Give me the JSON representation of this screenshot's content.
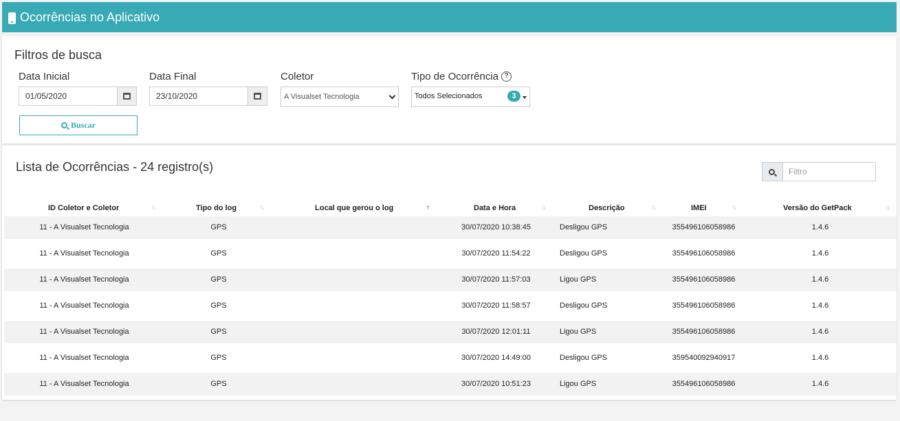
{
  "header": {
    "title": "Ocorrências no Aplicativo"
  },
  "filters": {
    "title": "Filtros de busca",
    "data_inicial": {
      "label": "Data Inicial",
      "value": "01/05/2020"
    },
    "data_final": {
      "label": "Data Final",
      "value": "23/10/2020"
    },
    "coletor": {
      "label": "Coletor",
      "value": "A Visualset Tecnologia"
    },
    "tipo": {
      "label": "Tipo de Ocorrência",
      "help": "?",
      "value": "Todos Selecionados",
      "count": "3"
    },
    "buscar_label": "Buscar"
  },
  "list": {
    "title": "Lista de Ocorrências - 24 registro(s)",
    "filter_placeholder": "Filtro",
    "columns": [
      "ID Coletor e Coletor",
      "Tipo do log",
      "Local que gerou o log",
      "Data e Hora",
      "Descrição",
      "IMEI",
      "Versão do GetPack"
    ],
    "rows": [
      [
        "11 - A Visualset Tecnologia",
        "GPS",
        "",
        "30/07/2020 10:38:45",
        "Desligou GPS",
        "355496106058986",
        "1.4.6"
      ],
      [
        "11 - A Visualset Tecnologia",
        "GPS",
        "",
        "30/07/2020 11:54:22",
        "Desligou GPS",
        "355496106058986",
        "1.4.6"
      ],
      [
        "11 - A Visualset Tecnologia",
        "GPS",
        "",
        "30/07/2020 11:57:03",
        "Ligou GPS",
        "355496106058986",
        "1.4.6"
      ],
      [
        "11 - A Visualset Tecnologia",
        "GPS",
        "",
        "30/07/2020 11:58:57",
        "Desligou GPS",
        "355496106058986",
        "1.4.6"
      ],
      [
        "11 - A Visualset Tecnologia",
        "GPS",
        "",
        "30/07/2020 12:01:11",
        "Ligou GPS",
        "355496106058986",
        "1.4.6"
      ],
      [
        "11 - A Visualset Tecnologia",
        "GPS",
        "",
        "30/07/2020 14:49:00",
        "Desligou GPS",
        "359540092940917",
        "1.4.6"
      ],
      [
        "11 - A Visualset Tecnologia",
        "GPS",
        "",
        "30/07/2020 10:51:23",
        "Ligou GPS",
        "355496106058986",
        "1.4.6"
      ]
    ]
  },
  "colors": {
    "accent": "#37aab5",
    "row_stripe": "#f2f2f2"
  },
  "icons": {
    "header": "phone-icon",
    "date": "calendar-icon",
    "search": "search-icon",
    "sort": "sort-icon"
  }
}
